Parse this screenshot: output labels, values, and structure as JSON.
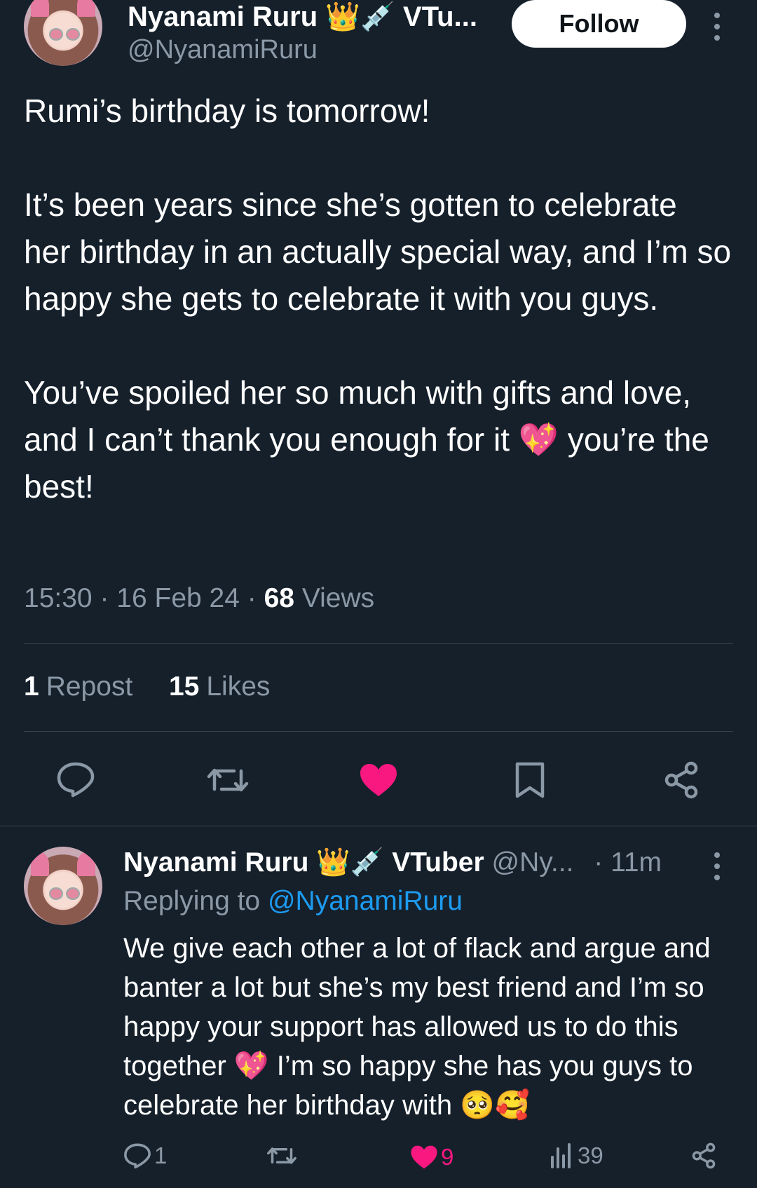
{
  "post": {
    "author_name": "Nyanami Ruru",
    "author_emoji": "👑💉",
    "author_suffix": "VTu...",
    "handle": "@NyanamiRuru",
    "follow_label": "Follow",
    "paragraphs": [
      "Rumi’s birthday is tomorrow!",
      "It’s been years since she’s gotten to celebrate her birthday in an actually special way, and I’m so happy she gets to celebrate it with you guys.",
      "You’ve spoiled her so much with gifts and love, and I can’t thank you enough for it 💖 you’re the best!"
    ],
    "time": "15:30",
    "date": "16 Feb 24",
    "views_count": "68",
    "views_label": "Views",
    "reposts_count": "1",
    "reposts_label": "Repost",
    "likes_count": "15",
    "likes_label": "Likes"
  },
  "actions": {
    "reply_icon": "reply-icon",
    "repost_icon": "repost-icon",
    "like_icon": "heart-icon",
    "bookmark_icon": "bookmark-icon",
    "share_icon": "share-icon"
  },
  "reply": {
    "author_name": "Nyanami Ruru",
    "author_emoji": "👑💉",
    "author_suffix": "VTuber",
    "handle": "@Ny...",
    "time": "· 11m",
    "replying_prefix": "Replying to",
    "replying_handle": "@NyanamiRuru",
    "text": "We give each other a lot of flack and argue and banter a lot but she’s my best friend and I’m so happy your support has allowed us to do this together 💖 I’m so happy she has you guys to celebrate her birthday with 🥺🥰",
    "reply_count": "1",
    "like_count": "9",
    "views_count": "39"
  },
  "colors": {
    "background": "#15202b",
    "muted": "#8b98a5",
    "like_pink": "#f91880",
    "link_blue": "#1d9bf0"
  }
}
